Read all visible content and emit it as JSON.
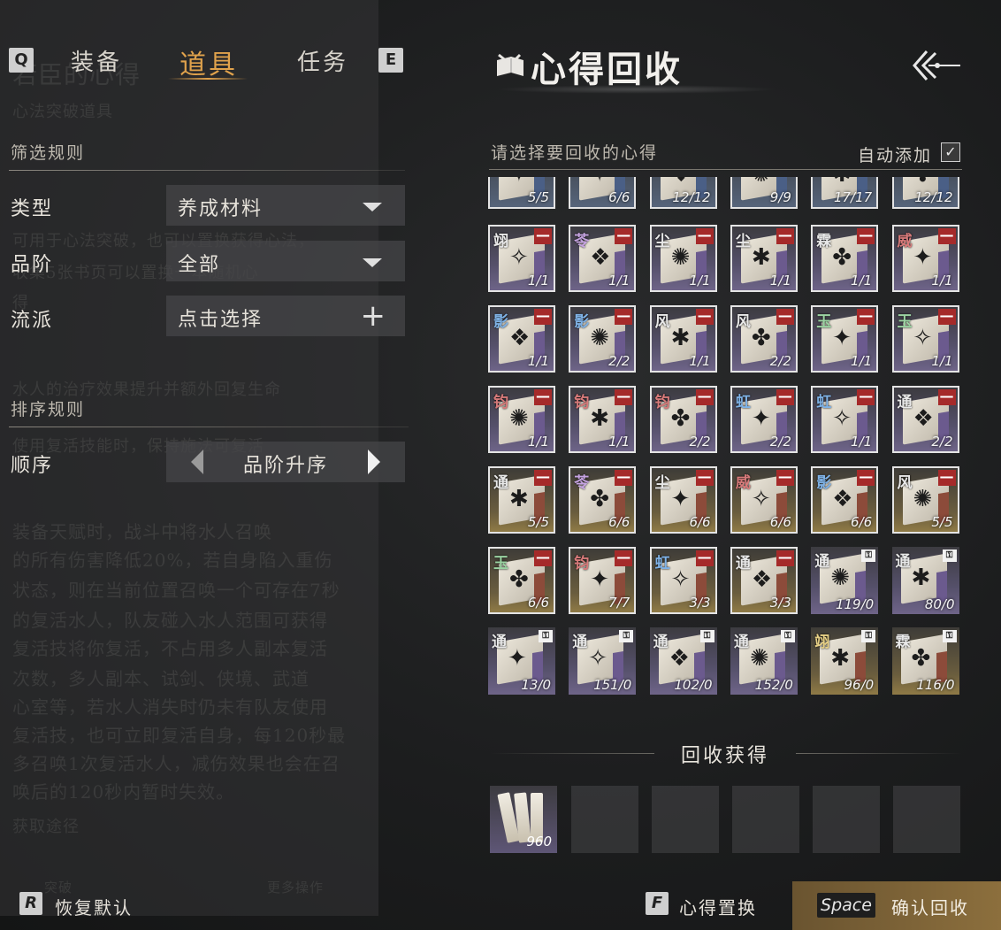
{
  "tabs": {
    "prev_key": "Q",
    "next_key": "E",
    "items": [
      {
        "label": "装备",
        "active": false
      },
      {
        "label": "道具",
        "active": true
      },
      {
        "label": "任务",
        "active": false
      }
    ]
  },
  "filter": {
    "section_title": "筛选规则",
    "type_label": "类型",
    "type_value": "养成材料",
    "grade_label": "品阶",
    "grade_value": "全部",
    "school_label": "流派",
    "school_value": "点击选择"
  },
  "sort": {
    "section_title": "排序规则",
    "order_label": "顺序",
    "order_value": "品阶升序"
  },
  "reset": {
    "key": "R",
    "label": "恢复默认"
  },
  "panel": {
    "title": "心得回收",
    "prompt": "请选择要回收的心得",
    "auto_add_label": "自动添加",
    "auto_add_checked": true
  },
  "grid_rows": [
    {
      "quality": "blue",
      "partial": true,
      "items": [
        {
          "char": "",
          "count": "5/5",
          "selected": true
        },
        {
          "char": "",
          "count": "6/6",
          "selected": true
        },
        {
          "char": "",
          "count": "12/12",
          "selected": true
        },
        {
          "char": "",
          "count": "9/9",
          "selected": true
        },
        {
          "char": "",
          "count": "17/17",
          "selected": true
        },
        {
          "char": "",
          "count": "12/12",
          "selected": true
        }
      ]
    },
    {
      "quality": "purple",
      "items": [
        {
          "char": "翊",
          "color": "white",
          "count": "1/1",
          "selected": true,
          "remove": true
        },
        {
          "char": "苓",
          "color": "purple",
          "count": "1/1",
          "selected": true,
          "remove": true
        },
        {
          "char": "尘",
          "color": "white",
          "count": "1/1",
          "selected": true,
          "remove": true
        },
        {
          "char": "尘",
          "color": "white",
          "count": "1/1",
          "selected": true,
          "remove": true
        },
        {
          "char": "霖",
          "color": "white",
          "count": "1/1",
          "selected": true,
          "remove": true
        },
        {
          "char": "威",
          "color": "red",
          "count": "1/1",
          "selected": true,
          "remove": true
        }
      ]
    },
    {
      "quality": "purple",
      "items": [
        {
          "char": "影",
          "color": "blue",
          "count": "1/1",
          "selected": true,
          "remove": true
        },
        {
          "char": "影",
          "color": "blue",
          "count": "2/2",
          "selected": true,
          "remove": true
        },
        {
          "char": "风",
          "color": "white",
          "count": "1/1",
          "selected": true,
          "remove": true
        },
        {
          "char": "风",
          "color": "white",
          "count": "2/2",
          "selected": true,
          "remove": true
        },
        {
          "char": "玉",
          "color": "green",
          "count": "1/1",
          "selected": true,
          "remove": true
        },
        {
          "char": "玉",
          "color": "green",
          "count": "1/1",
          "selected": true,
          "remove": true
        }
      ]
    },
    {
      "quality": "purple",
      "items": [
        {
          "char": "钧",
          "color": "red",
          "count": "1/1",
          "selected": true,
          "remove": true
        },
        {
          "char": "钧",
          "color": "red",
          "count": "1/1",
          "selected": true,
          "remove": true
        },
        {
          "char": "钧",
          "color": "red",
          "count": "2/2",
          "selected": true,
          "remove": true
        },
        {
          "char": "虹",
          "color": "blue",
          "count": "2/2",
          "selected": true,
          "remove": true
        },
        {
          "char": "虹",
          "color": "blue",
          "count": "1/1",
          "selected": true,
          "remove": true
        },
        {
          "char": "通",
          "color": "white",
          "count": "2/2",
          "selected": true,
          "remove": true
        }
      ]
    },
    {
      "quality": "gold",
      "items": [
        {
          "char": "通",
          "color": "white",
          "count": "5/5",
          "selected": true,
          "remove": true
        },
        {
          "char": "苓",
          "color": "purple",
          "count": "6/6",
          "selected": true,
          "remove": true
        },
        {
          "char": "尘",
          "color": "white",
          "count": "6/6",
          "selected": true,
          "remove": true
        },
        {
          "char": "威",
          "color": "red",
          "count": "6/6",
          "selected": true,
          "remove": true
        },
        {
          "char": "影",
          "color": "blue",
          "count": "6/6",
          "selected": true,
          "remove": true
        },
        {
          "char": "风",
          "color": "white",
          "count": "5/5",
          "selected": true,
          "remove": true
        }
      ]
    },
    {
      "quality": "gold",
      "items": [
        {
          "char": "玉",
          "color": "green",
          "count": "6/6",
          "selected": true,
          "remove": true
        },
        {
          "char": "钧",
          "color": "red",
          "count": "7/7",
          "selected": true,
          "remove": true
        },
        {
          "char": "虹",
          "color": "blue",
          "count": "3/3",
          "selected": true,
          "remove": true
        },
        {
          "char": "通",
          "color": "white",
          "count": "3/3",
          "selected": true,
          "remove": true
        },
        {
          "char": "通",
          "color": "white",
          "count": "119/0",
          "selected": false,
          "locked": true,
          "quality": "purple"
        },
        {
          "char": "通",
          "color": "white",
          "count": "80/0",
          "selected": false,
          "locked": true,
          "quality": "purple"
        }
      ]
    },
    {
      "quality": "purple",
      "items": [
        {
          "char": "通",
          "color": "white",
          "count": "13/0",
          "selected": false,
          "locked": true
        },
        {
          "char": "通",
          "color": "white",
          "count": "151/0",
          "selected": false,
          "locked": true
        },
        {
          "char": "通",
          "color": "white",
          "count": "102/0",
          "selected": false,
          "locked": true
        },
        {
          "char": "通",
          "color": "white",
          "count": "152/0",
          "selected": false,
          "locked": true
        },
        {
          "char": "翊",
          "color": "yellow",
          "count": "96/0",
          "selected": false,
          "locked": true,
          "quality": "gold"
        },
        {
          "char": "霖",
          "color": "white",
          "count": "116/0",
          "selected": false,
          "locked": true,
          "quality": "gold"
        }
      ]
    }
  ],
  "gains": {
    "title": "回收获得",
    "items": [
      {
        "count": "960"
      }
    ],
    "empty_slots": 5
  },
  "footer": {
    "swap_key": "F",
    "swap_label": "心得置换",
    "confirm_key": "Space",
    "confirm_label": "确认回收"
  },
  "background_text": {
    "l1": "若臣的心得",
    "l2": "心法突破道具",
    "l3": "可用于心法突破，也可以置换获得心法，",
    "l4": "收集5张书页可以置换一本随机心",
    "l5": "得",
    "l6": "水人的治疗效果提升并额外回复生命",
    "l7": "使用复活技能时，保持施法可复活",
    "l8": "装备天赋时，战斗中将水人召唤",
    "l9": "的所有伤害降低20%，若自身陷入重伤",
    "l10": "状态，则在当前位置召唤一个可存在7秒",
    "l11": "的复活水人，队友碰入水人范围可获得",
    "l12": "复活技将你复活，不占用多人副本复活",
    "l13": "次数，多人副本、试剑、侠境、武道",
    "l14": "心室等，若水人消失时仍未有队友使用",
    "l15": "复活技，也可立即复活自身，每120秒最",
    "l16": "多召唤1次复活水人，减伤效果也会在召",
    "l17": "唤后的120秒内暂时失效。",
    "l18": "获取途径",
    "l19": "突破",
    "l20": "更多操作"
  }
}
